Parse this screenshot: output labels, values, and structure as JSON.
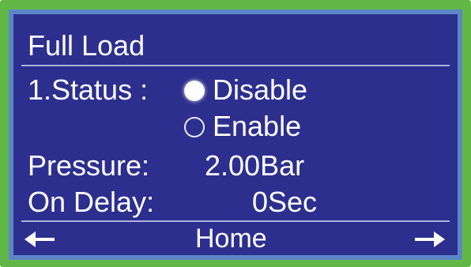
{
  "screen": {
    "title": "Full Load",
    "status": {
      "label": "1.Status :",
      "options": [
        {
          "label": "Disable",
          "selected": true
        },
        {
          "label": "Enable",
          "selected": false
        }
      ]
    },
    "pressure": {
      "label": "Pressure:",
      "value": "2.00Bar"
    },
    "on_delay": {
      "label": "On Delay:",
      "value": "0Sec"
    },
    "nav": {
      "left_icon": "left-arrow-icon",
      "center_label": "Home",
      "right_icon": "right-arrow-icon"
    }
  },
  "colors": {
    "outer_bezel": "#62b846",
    "inner_bezel": "#5d86c8",
    "screen_bg": "#2c2f8e",
    "text": "#ffffff",
    "divider": "#aeb3da"
  }
}
